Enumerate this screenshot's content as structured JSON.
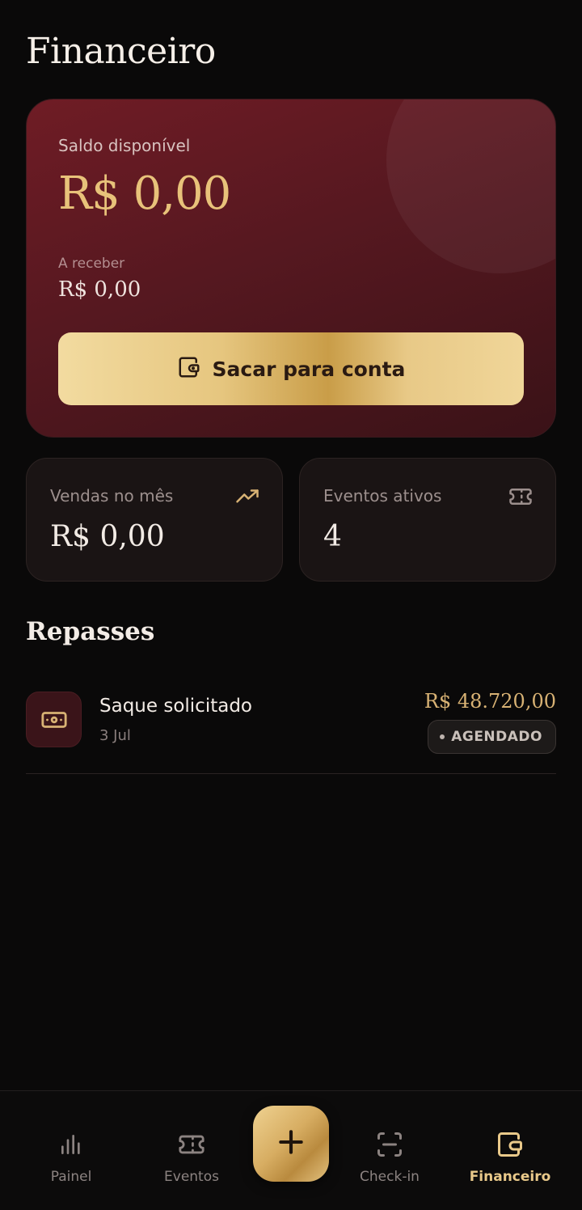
{
  "page": {
    "title": "Financeiro"
  },
  "balance": {
    "label": "Saldo disponível",
    "value": "R$ 0,00",
    "receivable_label": "A receber",
    "receivable_value": "R$ 0,00",
    "withdraw_button": "Sacar para conta",
    "withdraw_icon": "wallet-icon"
  },
  "stats": [
    {
      "label": "Vendas no mês",
      "value": "R$ 0,00",
      "icon": "trending-up-icon"
    },
    {
      "label": "Eventos ativos",
      "value": "4",
      "icon": "ticket-icon"
    }
  ],
  "transfers": {
    "title": "Repasses",
    "items": [
      {
        "title": "Saque solicitado",
        "date": "3 Jul",
        "amount": "R$ 48.720,00",
        "status": "AGENDADO",
        "icon": "banknote-icon"
      }
    ]
  },
  "nav": {
    "items": [
      {
        "label": "Painel",
        "icon": "bar-chart-icon",
        "active": false
      },
      {
        "label": "Eventos",
        "icon": "ticket-icon",
        "active": false
      },
      {
        "label": "Check-in",
        "icon": "scan-icon",
        "active": false
      },
      {
        "label": "Financeiro",
        "icon": "wallet-icon",
        "active": true
      }
    ],
    "fab_icon": "plus-icon"
  },
  "colors": {
    "background": "#0a0909",
    "accent_gold": "#e8c27a",
    "card_wine": "#6f1c25",
    "card_dark": "#1a1414"
  }
}
